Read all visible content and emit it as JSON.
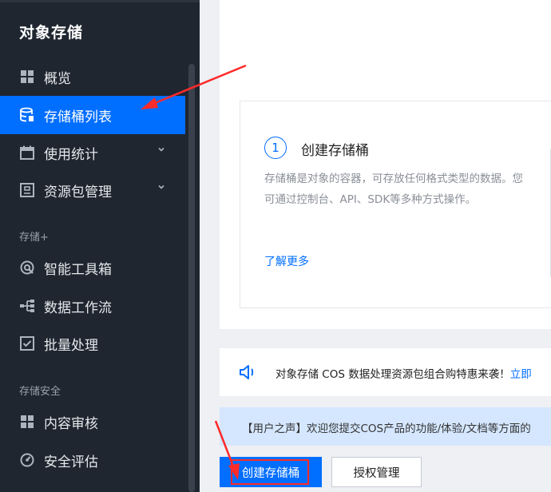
{
  "sidebar": {
    "title": "对象存储",
    "items": [
      {
        "label": "概览",
        "icon": "grid-icon"
      },
      {
        "label": "存储桶列表",
        "icon": "database-icon",
        "active": true
      },
      {
        "label": "使用统计",
        "icon": "calendar-icon",
        "expandable": true
      },
      {
        "label": "资源包管理",
        "icon": "package-icon",
        "expandable": true
      }
    ],
    "section_storage_plus": "存储+",
    "plus_items": [
      {
        "label": "智能工具箱",
        "icon": "toolbox-icon"
      },
      {
        "label": "数据工作流",
        "icon": "workflow-icon"
      },
      {
        "label": "批量处理",
        "icon": "checkbox-icon"
      }
    ],
    "section_security": "存储安全",
    "security_items": [
      {
        "label": "内容审核",
        "icon": "grid-icon"
      },
      {
        "label": "安全评估",
        "icon": "gauge-icon"
      }
    ]
  },
  "step": {
    "number": "1",
    "title": "创建存储桶",
    "description": "存储桶是对象的容器，可存放任何格式类型的数据。您可通过控制台、API、SDK等多种方式操作。",
    "link": "了解更多"
  },
  "notice": {
    "text": "对象存储 COS 数据处理资源包组合购特惠来袭！",
    "link": "立即"
  },
  "feedback": {
    "text": "【用户之声】欢迎您提交COS产品的功能/体验/文档等方面的"
  },
  "buttons": {
    "create": "创建存储桶",
    "auth": "授权管理"
  },
  "colors": {
    "accent": "#006eff",
    "sidebar_bg": "#1f2630",
    "annotation": "#ff2a2a"
  }
}
